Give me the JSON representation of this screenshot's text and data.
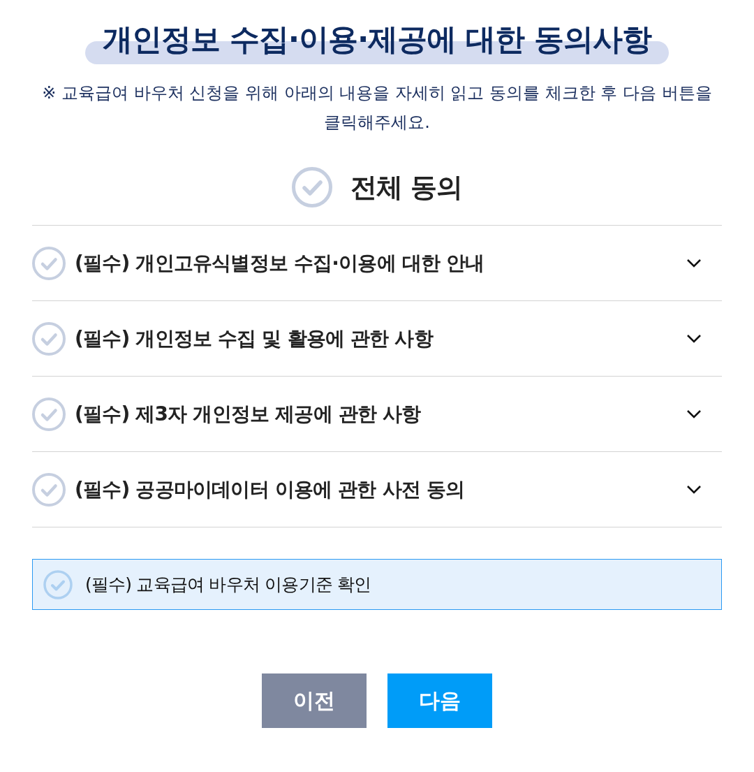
{
  "title": "개인정보 수집·이용·제공에 대한 동의사항",
  "notice": "※ 교육급여 바우처 신청을 위해 아래의 내용을 자세히 읽고 동의를 체크한 후 다음 버튼을 클릭해주세요.",
  "agree_all": {
    "label": "전체 동의",
    "checked": false
  },
  "items": [
    {
      "label": "(필수) 개인고유식별정보 수집·이용에 대한 안내",
      "checked": false,
      "expanded": false
    },
    {
      "label": "(필수) 개인정보 수집 및 활용에 관한 사항",
      "checked": false,
      "expanded": false
    },
    {
      "label": "(필수) 제3자 개인정보 제공에 관한 사항",
      "checked": false,
      "expanded": false
    },
    {
      "label": "(필수) 공공마이데이터 이용에 관한 사전 동의",
      "checked": false,
      "expanded": false
    }
  ],
  "confirm": {
    "label": "(필수) 교육급여 바우처 이용기준 확인",
    "checked": false
  },
  "buttons": [
    {
      "label": "이전",
      "kind": "prev"
    },
    {
      "label": "다음",
      "kind": "next"
    }
  ]
}
